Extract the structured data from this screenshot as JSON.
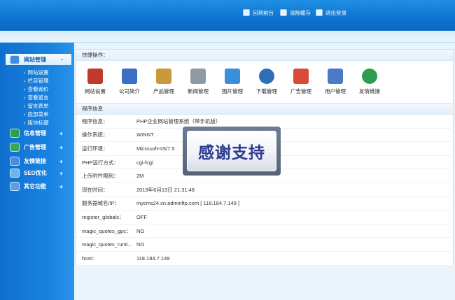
{
  "header": {
    "buttons": {
      "home": "回到前台",
      "clear_cache": "清除缓存",
      "logout": "退出登录"
    }
  },
  "sidebar": {
    "menus": [
      {
        "label": "网站管理",
        "toggle": "-"
      },
      {
        "label": "信息管理",
        "toggle": "+"
      },
      {
        "label": "广告管理",
        "toggle": "+"
      },
      {
        "label": "友情链接",
        "toggle": "+"
      },
      {
        "label": "SEO优化",
        "toggle": "+"
      },
      {
        "label": "其它功能",
        "toggle": "+"
      }
    ],
    "submenu": [
      "网站设置",
      "栏目管理",
      "查看询价",
      "查看留言",
      "留言表单",
      "底部菜单",
      "版块标题"
    ]
  },
  "quick": {
    "title": "快捷操作：",
    "items": [
      {
        "label": "网站设置",
        "color": "#c0392b"
      },
      {
        "label": "公司简介",
        "color": "#3a6fc4"
      },
      {
        "label": "产品管理",
        "color": "#c89a3a"
      },
      {
        "label": "新闻管理",
        "color": "#8e9aa6"
      },
      {
        "label": "图片管理",
        "color": "#3b8fd8"
      },
      {
        "label": "下载管理",
        "color": "#2f6fb8"
      },
      {
        "label": "广告管理",
        "color": "#d94a3a"
      },
      {
        "label": "用户管理",
        "color": "#4a7bc6"
      },
      {
        "label": "友情链接",
        "color": "#2f9d4f"
      }
    ]
  },
  "info": {
    "title": "程序信息",
    "rows": [
      {
        "key": "程序信息：",
        "value": "PHP企业网站管理系统（带手机版）"
      },
      {
        "key": "操作系统：",
        "value": "WINNT"
      },
      {
        "key": "运行环境：",
        "value": "Microsoft-IIS/7.5"
      },
      {
        "key": "PHP运行方式：",
        "value": "cgi-fcgi"
      },
      {
        "key": "上传附件限制：",
        "value": "2M"
      },
      {
        "key": "现在时间：",
        "value": "2019年6月13日 21:31:48"
      },
      {
        "key": "服务器域名/IP：",
        "value": "mycms24.cn.adminftp.com [ 118.184.7.149 ]"
      },
      {
        "key": "register_globals：",
        "value": "OFF"
      },
      {
        "key": "magic_quotes_gpc：",
        "value": "NO"
      },
      {
        "key": "magic_quotes_runti...",
        "value": "NO"
      },
      {
        "key": "host：",
        "value": "118.184.7.149"
      }
    ]
  },
  "overlay": {
    "text": "感谢支持"
  },
  "colors": {
    "header": "#0f74d1",
    "sidebar": "#1a84e2",
    "panel_border": "#c8dff2"
  }
}
